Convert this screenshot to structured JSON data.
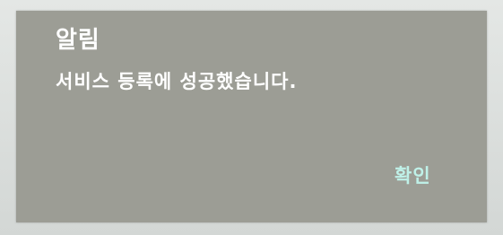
{
  "dialog": {
    "title": "알림",
    "message": "서비스 등록에 성공했습니다.",
    "confirm_label": "확인"
  },
  "colors": {
    "dialog_background": "#9c9d95",
    "text": "#ffffff",
    "confirm_text": "#bff1e8"
  }
}
